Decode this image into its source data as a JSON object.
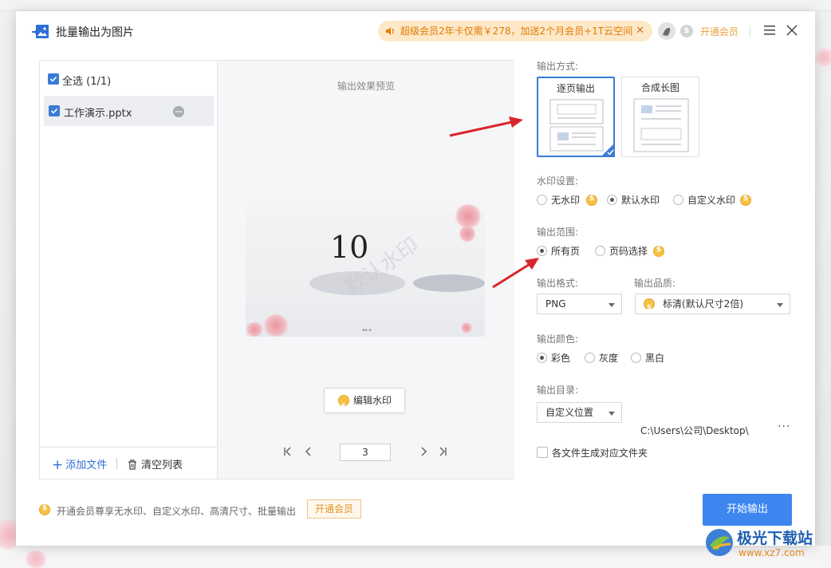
{
  "window": {
    "title": "批量输出为图片",
    "promo_text": "超级会员2年卡仅需￥278，加送2个月会员+1T云空间",
    "promo_close": "✕",
    "open_vip_label": "开通会员"
  },
  "file_list": {
    "select_all_label": "全选 (1/1)",
    "files": [
      {
        "name": "工作演示.pptx",
        "checked": true
      }
    ],
    "add_file_label": "添加文件",
    "clear_list_label": "清空列表"
  },
  "preview": {
    "label": "输出效果预览",
    "slide_number": "10",
    "watermark_text": "默认水印",
    "edit_watermark_label": "编辑水印",
    "current_page": "3"
  },
  "settings": {
    "output_mode_label": "输出方式:",
    "output_modes": [
      {
        "label": "逐页输出",
        "selected": true
      },
      {
        "label": "合成长图",
        "selected": false
      }
    ],
    "watermark_label": "水印设置:",
    "watermark_options": [
      {
        "label": "无水印",
        "selected": false,
        "vip": true
      },
      {
        "label": "默认水印",
        "selected": true,
        "vip": false
      },
      {
        "label": "自定义水印",
        "selected": false,
        "vip": true
      }
    ],
    "range_label": "输出范围:",
    "range_options": [
      {
        "label": "所有页",
        "selected": true,
        "vip": false
      },
      {
        "label": "页码选择",
        "selected": false,
        "vip": true
      }
    ],
    "format_label": "输出格式:",
    "format_value": "PNG",
    "quality_label": "输出品质:",
    "quality_value": "标清(默认尺寸2倍)",
    "color_label": "输出颜色:",
    "color_options": [
      {
        "label": "彩色",
        "selected": true
      },
      {
        "label": "灰度",
        "selected": false
      },
      {
        "label": "黑白",
        "selected": false
      }
    ],
    "dir_label": "输出目录:",
    "dir_mode_value": "自定义位置",
    "dir_path": "C:\\Users\\公司\\Desktop\\",
    "dir_more": "···",
    "subfolder_label": "各文件生成对应文件夹",
    "subfolder_checked": false
  },
  "footer": {
    "tip": "开通会员尊享无水印、自定义水印、高清尺寸、批量输出",
    "open_vip_label": "开通会员",
    "start_label": "开始输出"
  },
  "site_logo": {
    "name": "极光下载站",
    "url_text": "www.xz7.com"
  },
  "colors": {
    "accent": "#3d86f0",
    "vip_orange": "#e9a23b",
    "promo_bg": "#fde8c8",
    "annotation_arrow": "#d9262b"
  }
}
